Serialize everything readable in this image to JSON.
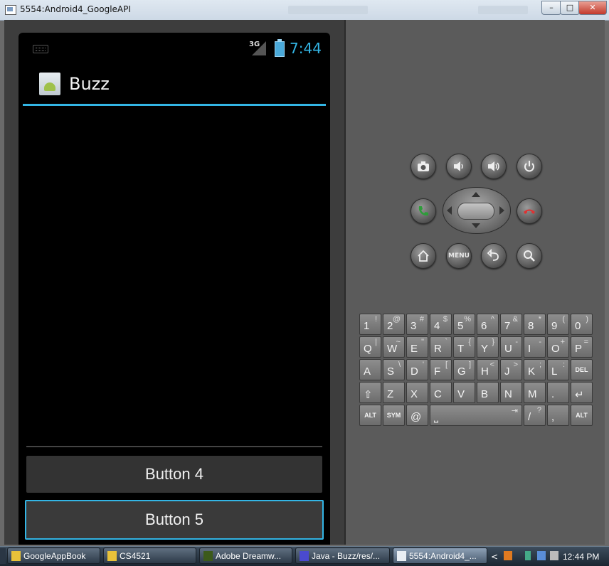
{
  "window": {
    "title": "5554:Android4_GoogleAPI",
    "minimize_label": "–",
    "maximize_label": "□",
    "close_label": "✕"
  },
  "status_bar": {
    "network": "3G",
    "time": "7:44",
    "accent_color": "#33b5e5"
  },
  "action_bar": {
    "title": "Buzz"
  },
  "buttons": {
    "button4": "Button 4",
    "button5": "Button 5"
  },
  "hardware_controls": {
    "menu_label": "MENU",
    "icons": [
      "camera-icon",
      "volume-down-icon",
      "volume-up-icon",
      "power-icon",
      "call-icon",
      "end-call-icon",
      "home-icon",
      "back-icon",
      "search-icon"
    ]
  },
  "keyboard": {
    "rows": [
      [
        {
          "m": "1",
          "s": "!"
        },
        {
          "m": "2",
          "s": "@"
        },
        {
          "m": "3",
          "s": "#"
        },
        {
          "m": "4",
          "s": "$"
        },
        {
          "m": "5",
          "s": "%"
        },
        {
          "m": "6",
          "s": "^"
        },
        {
          "m": "7",
          "s": "&"
        },
        {
          "m": "8",
          "s": "*"
        },
        {
          "m": "9",
          "s": "("
        },
        {
          "m": "0",
          "s": ")"
        }
      ],
      [
        {
          "m": "Q",
          "s": "|"
        },
        {
          "m": "W",
          "s": "~"
        },
        {
          "m": "E",
          "s": "\""
        },
        {
          "m": "R",
          "s": "`"
        },
        {
          "m": "T",
          "s": "{"
        },
        {
          "m": "Y",
          "s": "}"
        },
        {
          "m": "U",
          "s": "-"
        },
        {
          "m": "I",
          "s": "-"
        },
        {
          "m": "O",
          "s": "+"
        },
        {
          "m": "P",
          "s": "="
        }
      ],
      [
        {
          "m": "A",
          "s": ""
        },
        {
          "m": "S",
          "s": "\\"
        },
        {
          "m": "D",
          "s": "'"
        },
        {
          "m": "F",
          "s": "["
        },
        {
          "m": "G",
          "s": "]"
        },
        {
          "m": "H",
          "s": "<"
        },
        {
          "m": "J",
          "s": ">"
        },
        {
          "m": "K",
          "s": ";"
        },
        {
          "m": "L",
          "s": ":"
        },
        {
          "m": "DEL",
          "s": ""
        }
      ],
      [
        {
          "m": "⇧",
          "s": ""
        },
        {
          "m": "Z",
          "s": ""
        },
        {
          "m": "X",
          "s": ""
        },
        {
          "m": "C",
          "s": ""
        },
        {
          "m": "V",
          "s": ""
        },
        {
          "m": "B",
          "s": ""
        },
        {
          "m": "N",
          "s": ""
        },
        {
          "m": "M",
          "s": ""
        },
        {
          "m": ".",
          "s": ""
        },
        {
          "m": "↵",
          "s": ""
        }
      ],
      [
        {
          "m": "ALT",
          "s": ""
        },
        {
          "m": "SYM",
          "s": ""
        },
        {
          "m": "@",
          "s": ""
        },
        {
          "m": "⎵",
          "s": "⇥"
        },
        {
          "m": "/",
          "s": "?"
        },
        {
          "m": ",",
          "s": ""
        },
        {
          "m": "ALT",
          "s": ""
        }
      ]
    ]
  },
  "taskbar": {
    "tasks": [
      {
        "label": "GoogleAppBook",
        "icon": "folder-icon"
      },
      {
        "label": "CS4521",
        "icon": "folder-icon"
      },
      {
        "label": "Adobe Dreamw...",
        "icon": "dreamweaver-icon"
      },
      {
        "label": "Java - Buzz/res/...",
        "icon": "eclipse-icon"
      },
      {
        "label": "5554:Android4_...",
        "icon": "emulator-icon"
      }
    ],
    "clock": "12:44 PM"
  }
}
